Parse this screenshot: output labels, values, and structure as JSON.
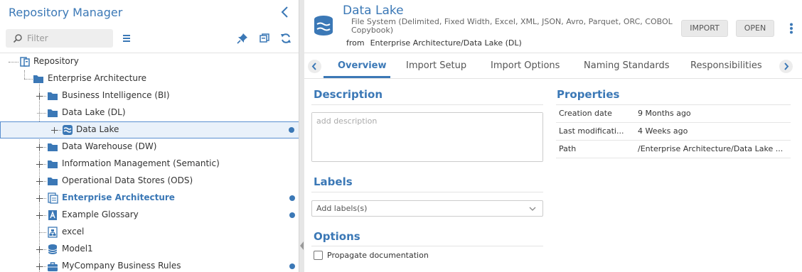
{
  "left_panel": {
    "title": "Repository Manager",
    "search_placeholder": "Filter",
    "tree": [
      {
        "label": "Repository"
      },
      {
        "label": "Enterprise Architecture"
      },
      {
        "label": "Business Intelligence (BI)"
      },
      {
        "label": "Data Lake (DL)"
      },
      {
        "label": "Data Lake",
        "selected": true,
        "badge": true
      },
      {
        "label": "Data Warehouse (DW)"
      },
      {
        "label": "Information Management (Semantic)"
      },
      {
        "label": "Operational Data Stores (ODS)"
      },
      {
        "label": "Enterprise Architecture",
        "bold": true,
        "badge": true
      },
      {
        "label": "Example Glossary",
        "badge": true
      },
      {
        "label": "excel"
      },
      {
        "label": "Model1"
      },
      {
        "label": "MyCompany Business Rules",
        "badge": true
      }
    ]
  },
  "header": {
    "title": "Data Lake",
    "subtitle": "File System (Delimited, Fixed Width, Excel, XML, JSON, Avro, Parquet, ORC, COBOL Copybook)",
    "from_label": "from",
    "from_path": "Enterprise Architecture/Data Lake (DL)",
    "import_button": "IMPORT",
    "open_button": "OPEN"
  },
  "tabs": [
    "Overview",
    "Import Setup",
    "Import Options",
    "Naming Standards",
    "Responsibilities"
  ],
  "active_tab": "Overview",
  "description": {
    "title": "Description",
    "placeholder": "add description"
  },
  "labels": {
    "title": "Labels",
    "placeholder": "Add labels(s)"
  },
  "options": {
    "title": "Options",
    "propagate_label": "Propagate documentation",
    "propagate_checked": false
  },
  "properties": {
    "title": "Properties",
    "rows": [
      {
        "key": "Creation date",
        "value": "9 Months ago"
      },
      {
        "key": "Last modificati...",
        "value": "4 Weeks ago"
      },
      {
        "key": "Path",
        "value": "/Enterprise Architecture/Data Lake ..."
      }
    ]
  },
  "colors": {
    "accent": "#3b78b6",
    "selection_bg": "#e9f1fa",
    "folder": "#3b78b6"
  }
}
